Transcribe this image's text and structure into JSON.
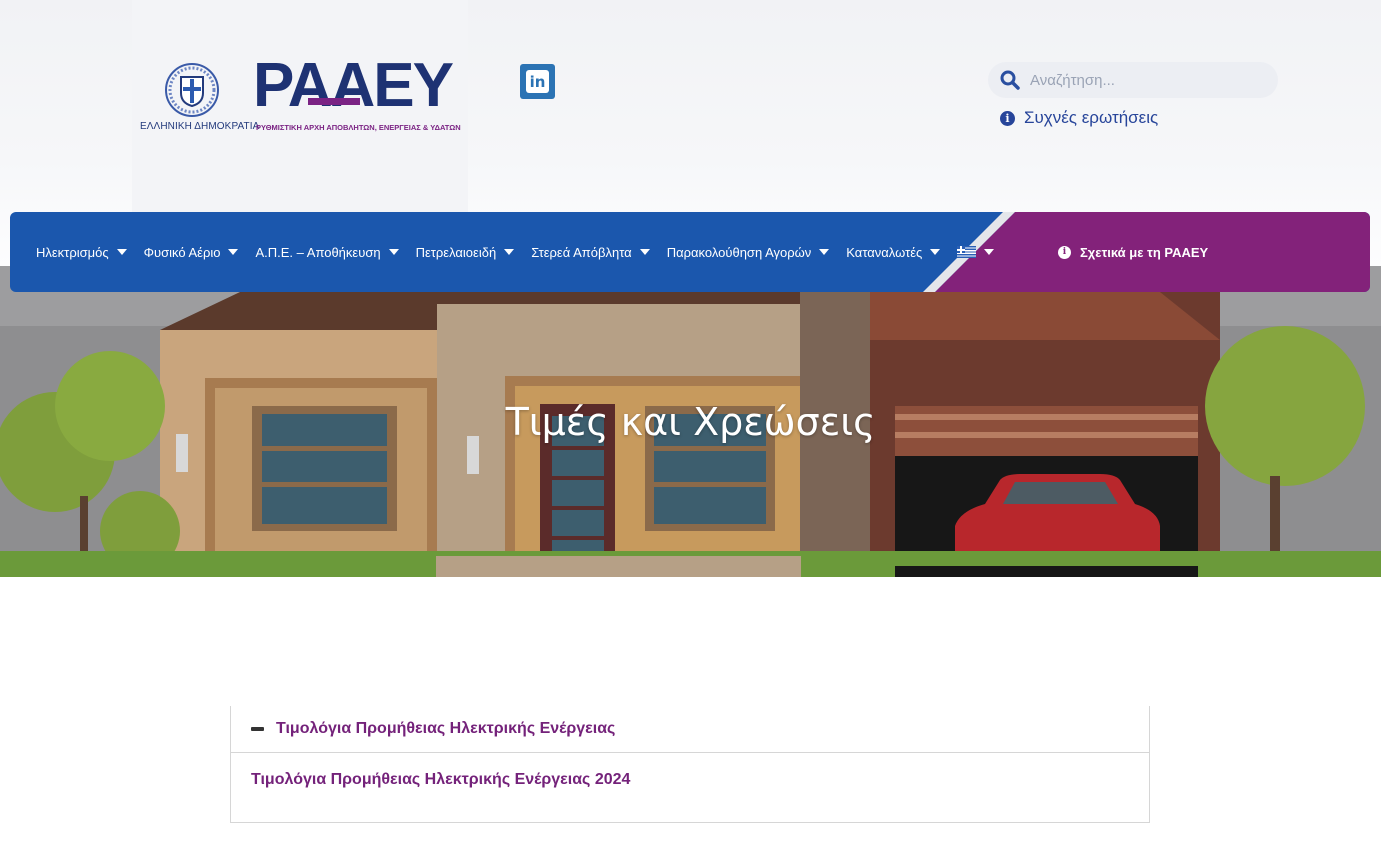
{
  "header": {
    "gov_label": "ΕΛΛΗΝΙΚΗ ΔΗΜΟΚΡΑΤΙΑ",
    "brand": "ΡΑΑΕΥ",
    "brand_subtitle": "ΡΥΘΜΙΣΤΙΚΗ ΑΡΧΗ ΑΠΟΒΛΗΤΩΝ, ΕΝΕΡΓΕΙΑΣ & ΥΔΑΤΩΝ",
    "linkedin_label": "in",
    "search_placeholder": "Αναζήτηση...",
    "faq_label": "Συχνές ερωτήσεις"
  },
  "nav": {
    "items": [
      {
        "label": "Ηλεκτρισμός"
      },
      {
        "label": "Φυσικό Αέριο"
      },
      {
        "label": "Α.Π.Ε. – Αποθήκευση"
      },
      {
        "label": "Πετρελαιοειδή"
      },
      {
        "label": "Στερεά Απόβλητα"
      },
      {
        "label": "Παρακολούθηση Αγορών"
      },
      {
        "label": "Καταναλωτές"
      }
    ],
    "about_label": "Σχετικά με τη ΡΑΑΕΥ"
  },
  "hero": {
    "title": "Τιμές και Χρεώσεις"
  },
  "accordion": {
    "title": "Τιμολόγια Προμήθειας Ηλεκτρικής Ενέργειας",
    "items": [
      {
        "label": "Τιμολόγια Προμήθειας Ηλεκτρικής Ενέργειας 2024"
      }
    ]
  },
  "colors": {
    "nav_blue": "#1b57ad",
    "nav_purple": "#83227a",
    "brand_navy": "#1e3273",
    "accent_purple": "#74227a"
  }
}
